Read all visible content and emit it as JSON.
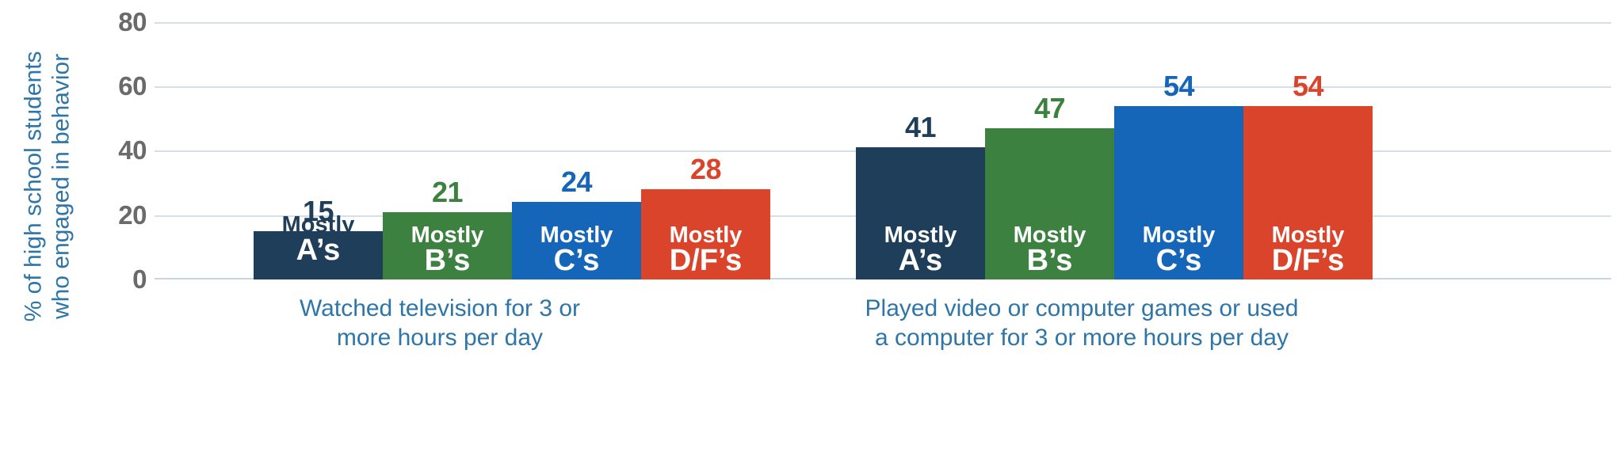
{
  "chart_data": {
    "type": "bar",
    "title": "",
    "xlabel": "",
    "ylabel": "% of high school students who engaged in behavior",
    "ylabel_lines": [
      "% of high school students",
      "who engaged in behavior"
    ],
    "ylim": [
      0,
      80
    ],
    "yticks": [
      0,
      20,
      40,
      60,
      80
    ],
    "ytick_labels": [
      "0",
      "20",
      "40",
      "60",
      "80"
    ],
    "grid": true,
    "grid_axis": "y",
    "legend": "none",
    "categories": [
      {
        "label": "Watched television for 3 or more hours per day",
        "label_lines": [
          "Watched television for 3 or",
          "more hours per day"
        ]
      },
      {
        "label": "Played video or computer games or used a computer for 3 or more hours per day",
        "label_lines": [
          "Played video or computer games or used",
          "a computer for 3 or more hours per day"
        ]
      }
    ],
    "series": [
      {
        "name": "Mostly A's",
        "label_lines": [
          "Mostly",
          "A’s"
        ],
        "color": "#1F3E5A",
        "values": [
          15,
          41
        ]
      },
      {
        "name": "Mostly B's",
        "label_lines": [
          "Mostly",
          "B’s"
        ],
        "color": "#3C8140",
        "values": [
          21,
          47
        ]
      },
      {
        "name": "Mostly C's",
        "label_lines": [
          "Mostly",
          "C’s"
        ],
        "color": "#1565B8",
        "values": [
          24,
          54
        ]
      },
      {
        "name": "Mostly D/F's",
        "label_lines": [
          "Mostly",
          "D/F’s"
        ],
        "color": "#D9442A",
        "values": [
          28,
          54
        ]
      }
    ],
    "colors": {
      "mostly_a": "#1F3E5A",
      "mostly_b": "#3C8140",
      "mostly_c": "#1565B8",
      "mostly_df": "#D9442A",
      "axis_label": "#2E75A8",
      "tick_label": "#6A6A6A",
      "gridline": "#D6DFE6",
      "background": "#FFFFFF"
    }
  },
  "groups": [
    {
      "caption_line1": "Watched television for 3 or",
      "caption_line2": "more hours per day",
      "bars": [
        {
          "value": "15",
          "label_top": "Mostly",
          "label_bottom": "A’s",
          "color": "#1F3E5A"
        },
        {
          "value": "21",
          "label_top": "Mostly",
          "label_bottom": "B’s",
          "color": "#3C8140"
        },
        {
          "value": "24",
          "label_top": "Mostly",
          "label_bottom": "C’s",
          "color": "#1565B8"
        },
        {
          "value": "28",
          "label_top": "Mostly",
          "label_bottom": "D/F’s",
          "color": "#D9442A"
        }
      ]
    },
    {
      "caption_line1": "Played video or computer games or used",
      "caption_line2": "a computer for 3 or more hours per day",
      "bars": [
        {
          "value": "41",
          "label_top": "Mostly",
          "label_bottom": "A’s",
          "color": "#1F3E5A"
        },
        {
          "value": "47",
          "label_top": "Mostly",
          "label_bottom": "B’s",
          "color": "#3C8140"
        },
        {
          "value": "54",
          "label_top": "Mostly",
          "label_bottom": "C’s",
          "color": "#1565B8"
        },
        {
          "value": "54",
          "label_top": "Mostly",
          "label_bottom": "D/F’s",
          "color": "#D9442A"
        }
      ]
    }
  ],
  "y_axis": {
    "title_line1": "% of high school students",
    "title_line2": "who engaged in behavior",
    "ticks": [
      "80",
      "60",
      "40",
      "20",
      "0"
    ]
  }
}
